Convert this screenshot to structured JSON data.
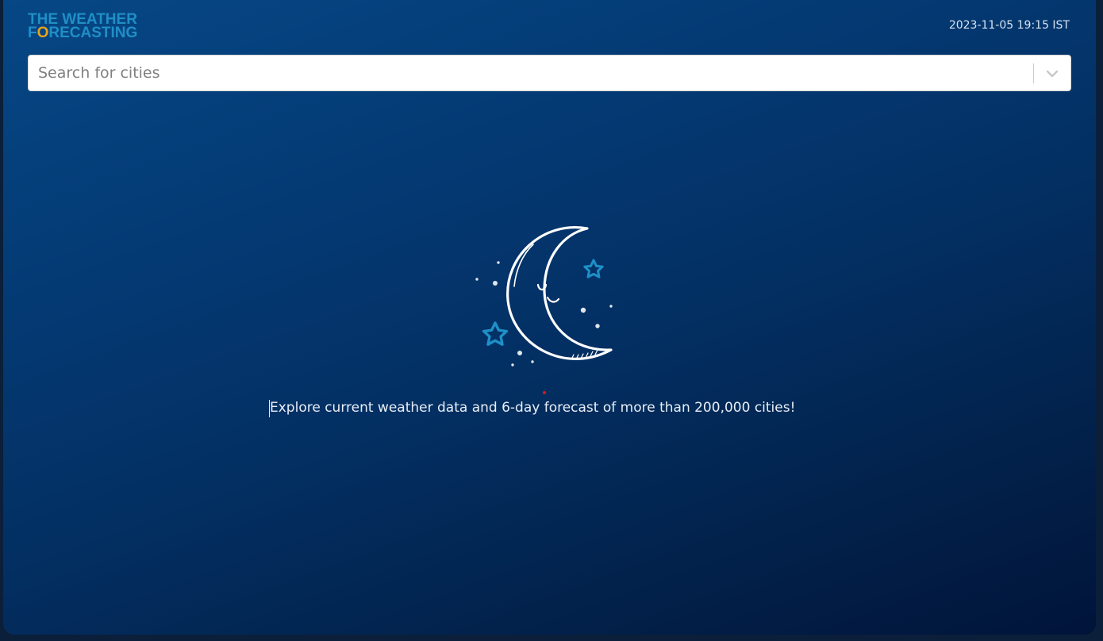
{
  "header": {
    "logo_line1": "THE WEATHER",
    "logo_line2_first": "F",
    "logo_line2_o": "O",
    "logo_line2_rest": "RECASTING",
    "datetime": "2023-11-05 19:15 IST"
  },
  "search": {
    "placeholder": "Search for cities",
    "value": ""
  },
  "main": {
    "illustration": "moon-stars-icon",
    "tagline": "Explore current weather data and 6-day forecast of more than 200,000 cities!"
  },
  "colors": {
    "background_top": "#064785",
    "background_bottom": "#01143a",
    "logo_blue": "#1f8fc7",
    "logo_accent": "#e8a21b",
    "star_blue": "#1f8fc7"
  }
}
